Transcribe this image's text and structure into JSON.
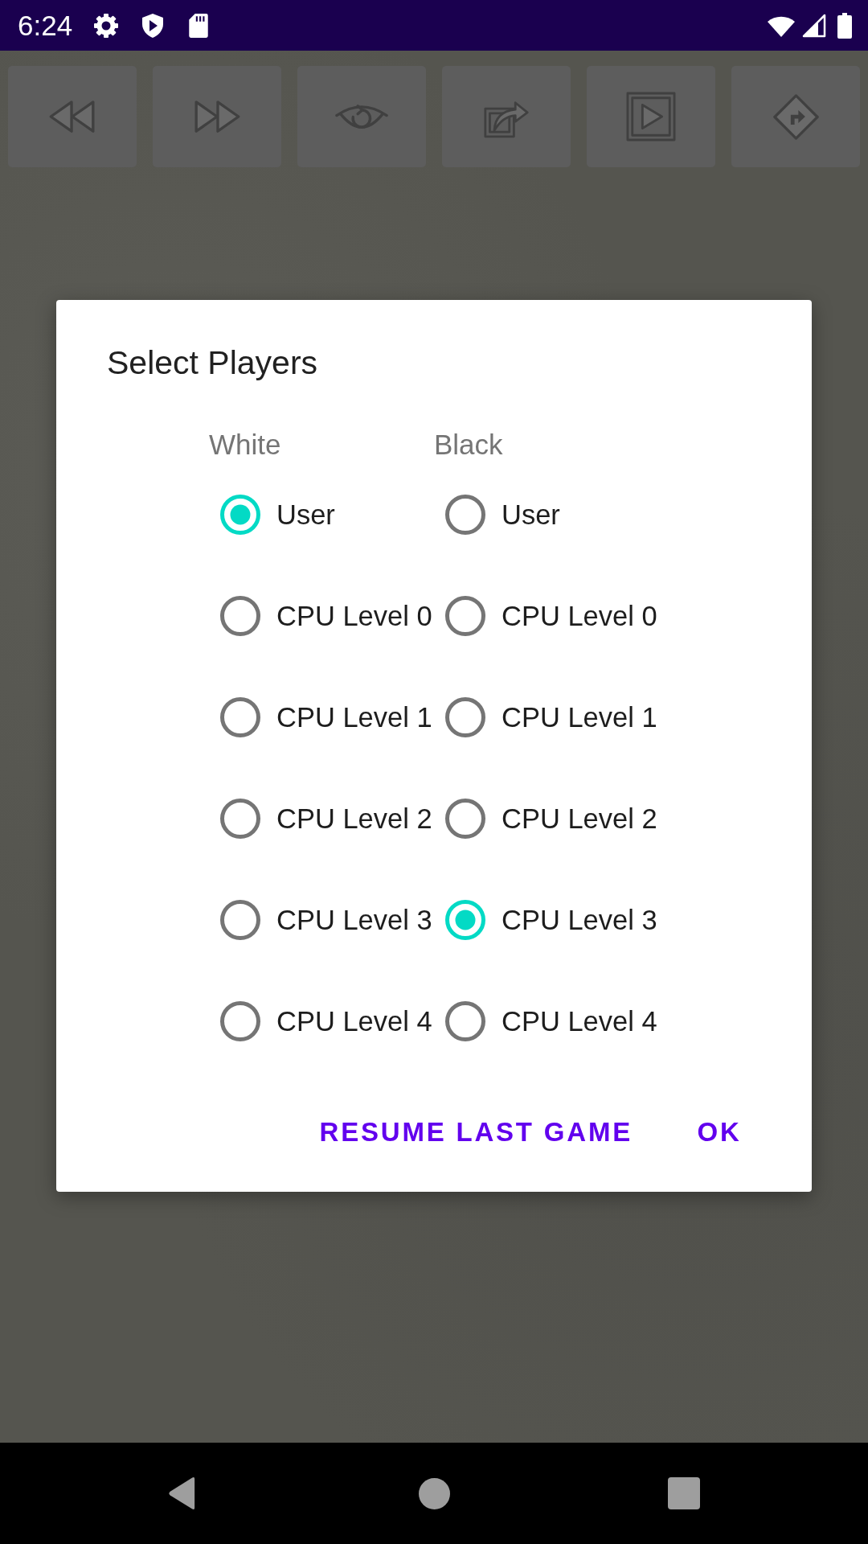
{
  "status_bar": {
    "time": "6:24"
  },
  "dialog": {
    "title": "Select Players",
    "columns": [
      {
        "header": "White",
        "options": [
          {
            "label": "User",
            "selected": true
          },
          {
            "label": "CPU Level 0",
            "selected": false
          },
          {
            "label": "CPU Level 1",
            "selected": false
          },
          {
            "label": "CPU Level 2",
            "selected": false
          },
          {
            "label": "CPU Level 3",
            "selected": false
          },
          {
            "label": "CPU Level 4",
            "selected": false
          }
        ]
      },
      {
        "header": "Black",
        "options": [
          {
            "label": "User",
            "selected": false
          },
          {
            "label": "CPU Level 0",
            "selected": false
          },
          {
            "label": "CPU Level 1",
            "selected": false
          },
          {
            "label": "CPU Level 2",
            "selected": false
          },
          {
            "label": "CPU Level 3",
            "selected": true
          },
          {
            "label": "CPU Level 4",
            "selected": false
          }
        ]
      }
    ],
    "buttons": [
      "RESUME LAST GAME",
      "OK"
    ]
  }
}
